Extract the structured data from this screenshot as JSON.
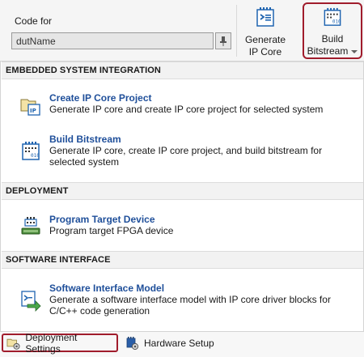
{
  "toolstrip": {
    "code_for_label": "Code for",
    "dut_value": "dutName",
    "generate_label_line1": "Generate",
    "generate_label_line2": "IP Core",
    "build_label_line1": "Build",
    "build_label_line2": "Bitstream"
  },
  "sections": [
    {
      "header": "EMBEDDED SYSTEM INTEGRATION",
      "items": [
        {
          "title": "Create IP Core Project",
          "desc": "Generate IP core and create IP core project for selected system",
          "icon": "ip-core-project-icon"
        },
        {
          "title": "Build Bitstream",
          "desc": "Generate IP core, create IP core project, and build bitstream for selected system",
          "icon": "bitstream-icon"
        }
      ]
    },
    {
      "header": "DEPLOYMENT",
      "items": [
        {
          "title": "Program Target Device",
          "desc": "Program target FPGA device",
          "icon": "fpga-device-icon"
        }
      ]
    },
    {
      "header": "SOFTWARE INTERFACE",
      "items": [
        {
          "title": "Software Interface Model",
          "desc": "Generate a software interface model with IP core driver blocks for C/C++ code generation",
          "icon": "software-interface-icon"
        }
      ]
    }
  ],
  "footer": {
    "deployment_settings": "Deployment Settings",
    "hardware_setup": "Hardware Setup"
  },
  "colors": {
    "highlight_border": "#a01c2c",
    "link_title": "#1f4f9a",
    "section_bg": "#f2f2f2"
  }
}
